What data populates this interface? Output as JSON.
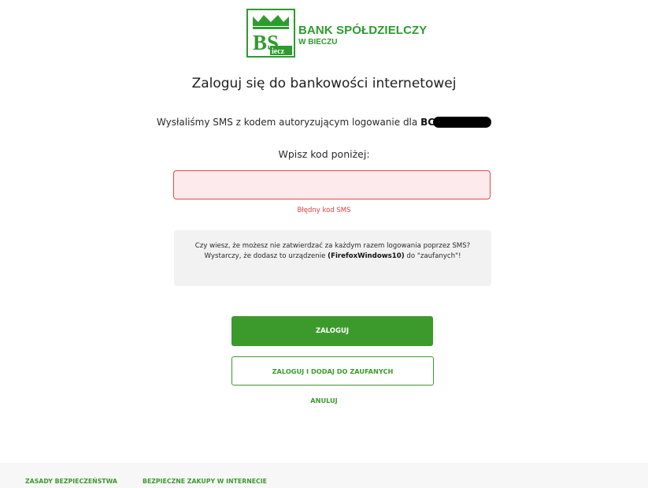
{
  "brand": {
    "name_line1": "BANK SPÓŁDZIELCZY",
    "name_line2": "W BIECZU",
    "logo_letters": "BS",
    "logo_sub": "iecz",
    "color": "#2e9b2e"
  },
  "page": {
    "title": "Zaloguj się do bankowości internetowej",
    "sms_info_prefix": "Wysłaliśmy SMS z kodem autoryzującym logowanie dla ",
    "login_id_visible": "BC",
    "enter_code": "Wpisz kod poniżej:"
  },
  "code_field": {
    "value": "",
    "placeholder": "",
    "error": "Błędny kod SMS"
  },
  "info_box": {
    "text_before": "Czy wiesz, że możesz nie zatwierdzać za każdym razem logowania poprzez SMS? Wystarczy, że dodasz to urządzenie ",
    "device_name": "(FirefoxWindows10)",
    "text_after": " do \"zaufanych\"!"
  },
  "actions": {
    "login_label": "ZALOGUJ",
    "login_trust_label": "ZALOGUJ I DODAJ DO ZAUFANYCH",
    "cancel_label": "ANULUJ"
  },
  "footer": {
    "links": [
      {
        "label": "ZASADY BEZPIECZEŃSTWA"
      },
      {
        "label": "BEZPIECZNE ZAKUPY W INTERNECIE"
      }
    ]
  },
  "colors": {
    "accent": "#3c9a2c",
    "error": "#e23b3b",
    "error_field_bg": "#fdeaec",
    "info_bg": "#f2f2f2"
  }
}
